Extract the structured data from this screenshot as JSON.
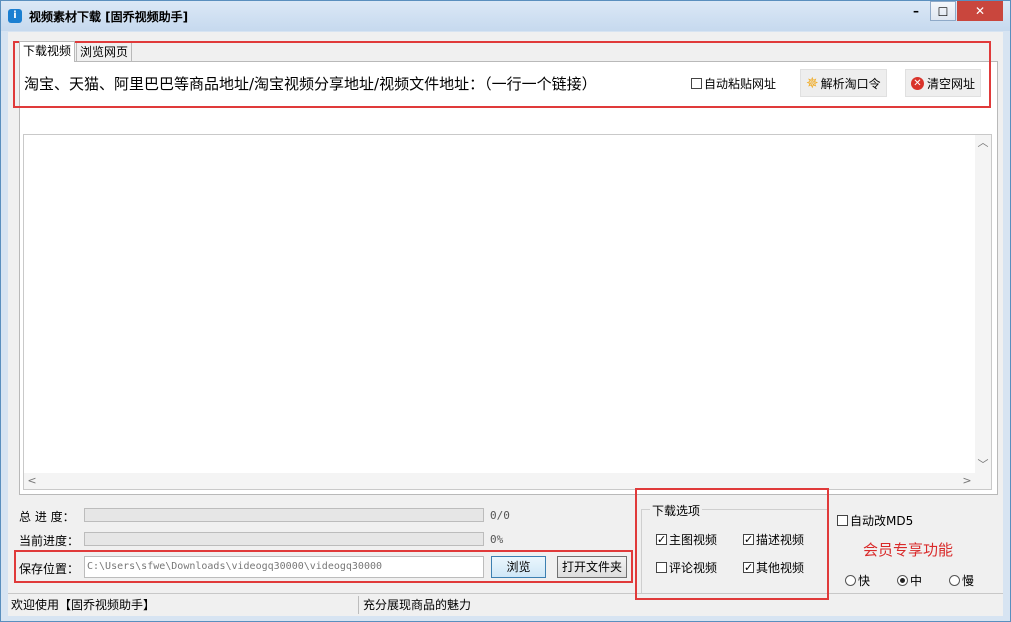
{
  "window": {
    "title": "视频素材下载 [固乔视频助手]",
    "icon": "app-info-icon",
    "controls": {
      "minimize": "–",
      "maximize": "☐",
      "close": "✕"
    }
  },
  "tabs": [
    {
      "label": "下载视频",
      "active": true
    },
    {
      "label": "浏览网页",
      "active": false
    }
  ],
  "download": {
    "hint": "淘宝、天猫、阿里巴巴等商品地址/淘宝视频分享地址/视频文件地址：（一行一个链接）",
    "auto_paste": {
      "label": "自动粘贴网址",
      "checked": false
    },
    "parse_button": "解析淘口令",
    "clear_button": "清空网址",
    "url_text": ""
  },
  "progress": {
    "total_label": "总 进 度：",
    "total_value": "0/0",
    "total_fraction": 0,
    "current_label": "当前进度：",
    "current_value": "0%",
    "current_fraction": 0
  },
  "save": {
    "label": "保存位置：",
    "path": "C:\\Users\\sfwe\\Downloads\\videogq30000\\videogq30000",
    "browse_button": "浏览",
    "open_folder_button": "打开文件夹"
  },
  "options": {
    "title": "下载选项",
    "main_video": {
      "label": "主图视频",
      "checked": true
    },
    "desc_video": {
      "label": "描述视频",
      "checked": true
    },
    "comment_video": {
      "label": "评论视频",
      "checked": false
    },
    "other_video": {
      "label": "其他视频",
      "checked": true
    }
  },
  "member": {
    "auto_md5": {
      "label": "自动改MD5",
      "checked": false
    },
    "title": "会员专享功能",
    "speed_fast": {
      "label": "快",
      "selected": false
    },
    "speed_mid": {
      "label": "中",
      "selected": true
    },
    "speed_slow": {
      "label": "慢",
      "selected": false
    }
  },
  "status": {
    "left": "欢迎使用【固乔视频助手】",
    "right": "充分展现商品的魅力"
  },
  "colors": {
    "highlight": "#e03a3a",
    "member_text": "#d92a2a",
    "close_bg": "#c9463d"
  }
}
